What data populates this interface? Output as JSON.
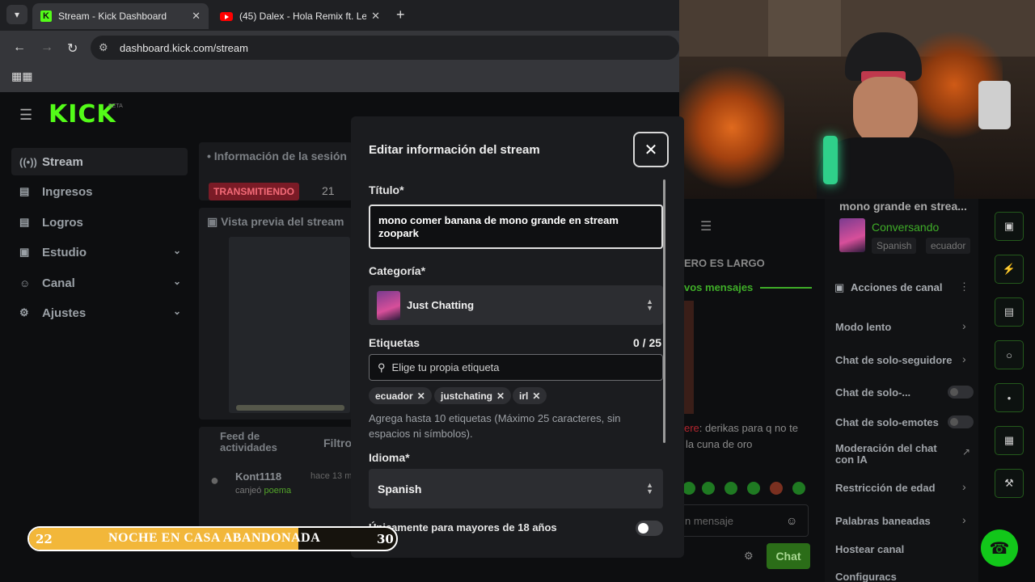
{
  "browser": {
    "tabs": [
      {
        "title": "Stream - Kick Dashboard",
        "favicon": "kick-icon"
      },
      {
        "title": "(45) Dalex - Hola Remix ft. Lenny",
        "favicon": "youtube-icon"
      }
    ],
    "url": "dashboard.kick.com/stream"
  },
  "dashboard": {
    "logo": "KICK",
    "logo_badge": "BETA",
    "sidebar": [
      {
        "label": "Stream",
        "icon": "broadcast-icon"
      },
      {
        "label": "Ingresos",
        "icon": "wallet-icon"
      },
      {
        "label": "Logros",
        "icon": "trophy-icon"
      },
      {
        "label": "Estudio",
        "icon": "studio-icon"
      },
      {
        "label": "Canal",
        "icon": "user-icon"
      },
      {
        "label": "Ajustes",
        "icon": "gear-icon"
      }
    ],
    "session_title": "Información de la sesión",
    "live_badge": "TRANSMITIENDO",
    "viewers": "21",
    "preview_title": "Vista previa del stream",
    "feed_title": "Feed de actividades",
    "filter": "Filtro",
    "feed_item": {
      "user": "Kont1118",
      "time": "hace 13 m",
      "action": "canjeó",
      "reward": "poema"
    }
  },
  "modal": {
    "title": "Editar información del stream",
    "title_label": "Título*",
    "title_value": "mono comer banana de mono grande en stream zoopark",
    "category_label": "Categoría*",
    "category_value": "Just Chatting",
    "tags_label": "Etiquetas",
    "tags_count": "0 / 25",
    "tags_placeholder": "Elige tu propia etiqueta",
    "tags": [
      "ecuador",
      "justchating",
      "irl"
    ],
    "tags_help": "Agrega hasta 10 etiquetas (Máximo 25 caracteres, sin espacios ni símbolos).",
    "language_label": "Idioma*",
    "language_value": "Spanish",
    "adult_label": "Únicamente para mayores de 18 años",
    "adult_enabled": false
  },
  "overlay": {
    "current": "22",
    "label": "NOCHE EN CASA ABANDONADA",
    "goal": "30",
    "progress": 0.733,
    "fill_color": "#f2b73a"
  },
  "chat": {
    "stream_title_preview": "mono grande en strea...",
    "category": "Conversando",
    "tags": [
      "Spanish",
      "ecuador"
    ],
    "pinned": "ERO ES LARGO",
    "new_messages": "vos mensajes",
    "message_user": "...",
    "message_text": ": derikas para q no te",
    "message_text2": "la cuna de oro",
    "input_placeholder": "n mensaje",
    "send": "Chat",
    "actions_title": "Acciones de canal",
    "actions": [
      "Modo lento",
      "Chat de solo-seguidore",
      "Chat de solo-...",
      "Chat de solo-emotes",
      "Moderación del chat con IA",
      "Restricción de edad",
      "Palabras baneadas",
      "Hostear canal",
      "Configuracs"
    ]
  },
  "colors": {
    "brand": "#53fc18",
    "live": "#7a1b26"
  }
}
